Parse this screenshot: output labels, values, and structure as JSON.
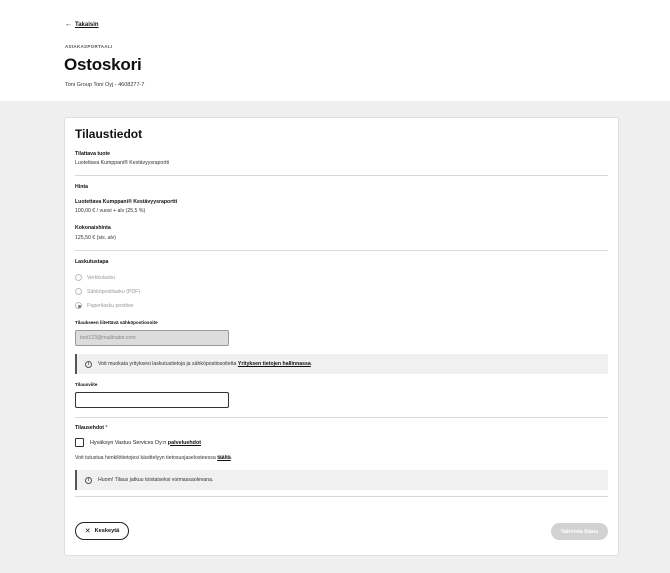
{
  "header": {
    "back_label": "Takaisin",
    "back_arrow": "←",
    "eyebrow": "ASIAKASPORTAALI",
    "title": "Ostoskori",
    "company": "Toni Group Toni Oyj - 4608277-7"
  },
  "order": {
    "heading": "Tilaustiedot",
    "product_label": "Tilattava tuote",
    "product_value": "Luotettava Kumppani® Kestävyysraportti",
    "price_heading": "Hinta",
    "price_item_label": "Luotettava Kumppani® Kestävyysraportti",
    "price_item_value": "100,00 € / vuosi + alv (25,5 %)",
    "total_label": "Kokonaishinta",
    "total_value": "125,50 € (sis. alv)"
  },
  "billing": {
    "heading": "Laskutustapa",
    "options": [
      {
        "label": "Verkkolasku",
        "selected": false
      },
      {
        "label": "Sähköpostilasku (PDF)",
        "selected": false
      },
      {
        "label": "Paperilasku postitse",
        "selected": true
      }
    ],
    "email_label": "Tilaukseen liitettävä sähköpostiosoite",
    "email_value": "toni123@mailinator.com",
    "info_text": "Voit muokata yrityksesi laskutustietoja ja sähköpostiosoitetta",
    "info_link": "Yrityksen tietojen hallinnassa",
    "info_suffix": ".",
    "reference_label": "Tilausviite",
    "reference_value": ""
  },
  "terms": {
    "heading": "Tilausehdot",
    "required_mark": "*",
    "checkbox_text": "Hyväksyn Vastuu Services Oy:n",
    "checkbox_link": "palveluehdot",
    "privacy_text": "Voit tutustua henkilötietojesi käsittelyyn tietosuojaselosteessa",
    "privacy_link": "täältä",
    "privacy_suffix": ".",
    "notice": "Huom! Tilaus jatkuu toistaiseksi voimassaolevana."
  },
  "actions": {
    "cancel_label": "Keskeytä",
    "cancel_icon": "✕",
    "confirm_label": "Vahvista tilaus"
  },
  "colors": {
    "page_bg": "#efefef",
    "card_bg": "#ffffff",
    "disabled_button": "#d2d2d2"
  }
}
